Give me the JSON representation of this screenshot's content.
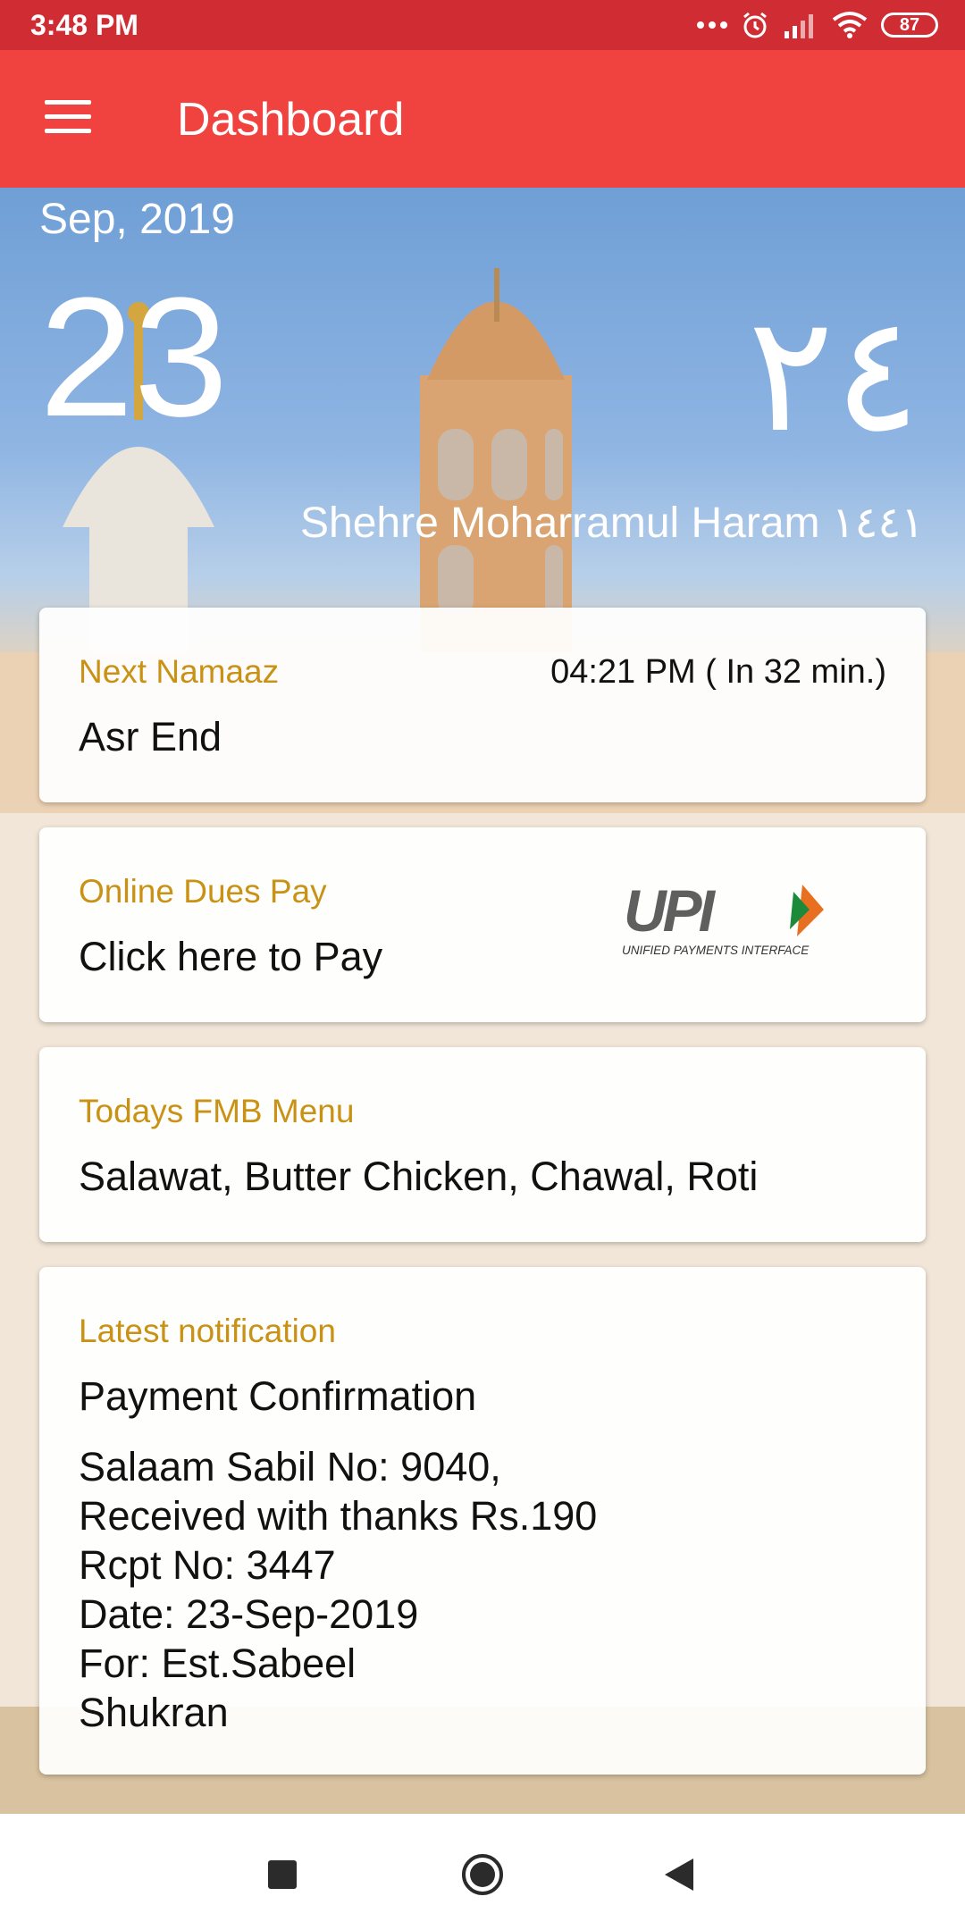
{
  "status_bar": {
    "time": "3:48 PM",
    "battery": "87",
    "icons": [
      "more-dots-icon",
      "alarm-icon",
      "signal-icon",
      "wifi-icon",
      "battery-icon"
    ]
  },
  "app_bar": {
    "title": "Dashboard",
    "menu_icon": "hamburger-menu-icon",
    "background": "#f0423f"
  },
  "calendar": {
    "month_year": "Sep, 2019",
    "day": "23",
    "hijri_day": "٢٤",
    "hijri_month_year": "Shehre Moharramul Haram ١٤٤١"
  },
  "cards": {
    "next_namaaz": {
      "label": "Next Namaaz",
      "value": "Asr End",
      "time": "04:21 PM ( In 32 min.)"
    },
    "online_dues": {
      "label": "Online Dues Pay",
      "value": "Click here to Pay",
      "logo_text": "UPI",
      "logo_subtext": "UNIFIED PAYMENTS INTERFACE"
    },
    "fmb_menu": {
      "label": "Todays FMB Menu",
      "value": "Salawat, Butter Chicken, Chawal, Roti"
    },
    "notification": {
      "label": "Latest notification",
      "title": "Payment Confirmation",
      "lines": [
        "Salaam Sabil No: 9040,",
        "Received with thanks Rs.190",
        "Rcpt No: 3447",
        "Date: 23-Sep-2019",
        "For: Est.Sabeel",
        "Shukran"
      ]
    }
  },
  "colors": {
    "status_bar": "#cf2d33",
    "accent_label": "#c99215"
  },
  "nav_bar": {
    "icons": [
      "recents-square-icon",
      "home-circle-icon",
      "back-triangle-icon"
    ]
  }
}
